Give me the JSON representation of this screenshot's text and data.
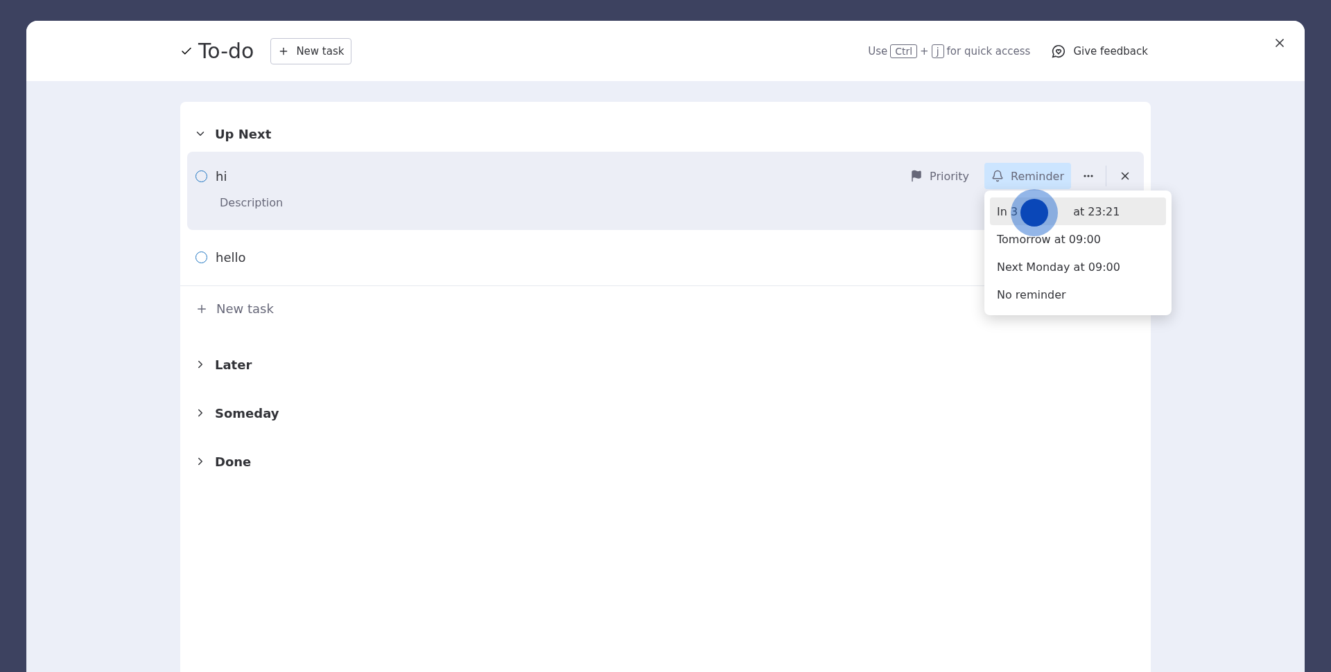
{
  "window": {
    "title": "To-do",
    "new_task_button": "New task",
    "shortcut": {
      "prefix": "Use",
      "keys": [
        "Ctrl",
        "j"
      ],
      "joiner": "+",
      "suffix": "for quick access"
    },
    "feedback": "Give feedback"
  },
  "groups": [
    {
      "title": "Up Next",
      "expanded": true,
      "tasks": [
        {
          "title": "hi",
          "description": "Description",
          "selected": true,
          "actions": {
            "priority": "Priority",
            "reminder": "Reminder",
            "reminder_active": true
          }
        },
        {
          "title": "hello",
          "selected": false
        }
      ],
      "new_task": "New task"
    },
    {
      "title": "Later",
      "expanded": false
    },
    {
      "title": "Someday",
      "expanded": false
    },
    {
      "title": "Done",
      "expanded": false
    }
  ],
  "reminder_menu": {
    "items": [
      {
        "parts": [
          "In 3",
          "at 23:21"
        ],
        "selected": true
      },
      {
        "parts": [
          "Tomorrow at 09:00"
        ],
        "selected": false
      },
      {
        "parts": [
          "Next Monday at 09:00"
        ],
        "selected": false
      },
      {
        "parts": [
          "No reminder"
        ],
        "selected": false
      }
    ]
  }
}
